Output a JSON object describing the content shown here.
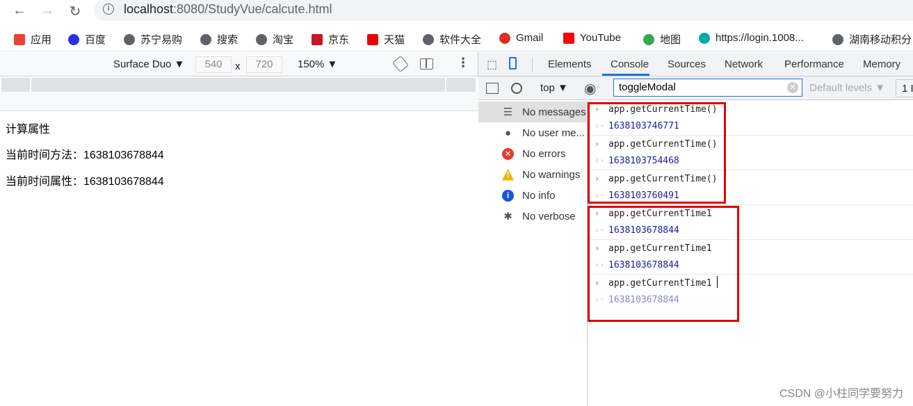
{
  "browser": {
    "url_host": "localhost",
    "url_rest": ":8080/StudyVue/calcute.html"
  },
  "bookmarks": [
    "应用",
    "百度",
    "苏宁易购",
    "搜索",
    "淘宝",
    "京东",
    "天猫",
    "软件大全",
    "Gmail",
    "YouTube",
    "地图",
    "https://login.1008...",
    "湖南移动积分"
  ],
  "device_toolbar": {
    "device": "Surface Duo ▼",
    "width": "540",
    "x": "x",
    "height": "720",
    "zoom": "150% ▼"
  },
  "page": {
    "title": "计算属性",
    "method_line": "当前时间方法：1638103678844",
    "prop_line": "当前时间属性：1638103678844"
  },
  "devtools": {
    "tabs": [
      "Elements",
      "Console",
      "Sources",
      "Network",
      "Performance",
      "Memory"
    ],
    "active_tab": "Console",
    "context": "top ▼",
    "filter": "toggleModal",
    "levels": "Default levels ▼",
    "issues": "1 I",
    "sidebar": [
      {
        "label": "No messages",
        "icon": "list-icon"
      },
      {
        "label": "No user me...",
        "icon": "user-icon"
      },
      {
        "label": "No errors",
        "icon": "error-icon",
        "color": "#e53935"
      },
      {
        "label": "No warnings",
        "icon": "warning-icon",
        "color": "#f4b400"
      },
      {
        "label": "No info",
        "icon": "info-icon",
        "color": "#1a56db"
      },
      {
        "label": "No verbose",
        "icon": "bug-icon"
      }
    ],
    "console": [
      {
        "cmd": "app.getCurrentTime()",
        "result": "1638103746771"
      },
      {
        "cmd": "app.getCurrentTime()",
        "result": "1638103754468"
      },
      {
        "cmd": "app.getCurrentTime()",
        "result": "1638103760491"
      },
      {
        "cmd": "app.getCurrentTime1",
        "result": "1638103678844"
      },
      {
        "cmd": "app.getCurrentTime1",
        "result": "1638103678844"
      },
      {
        "cmd": "app.getCurrentTime1",
        "result": "1638103678844"
      }
    ]
  },
  "watermark": "CSDN @小柱同学要努力"
}
